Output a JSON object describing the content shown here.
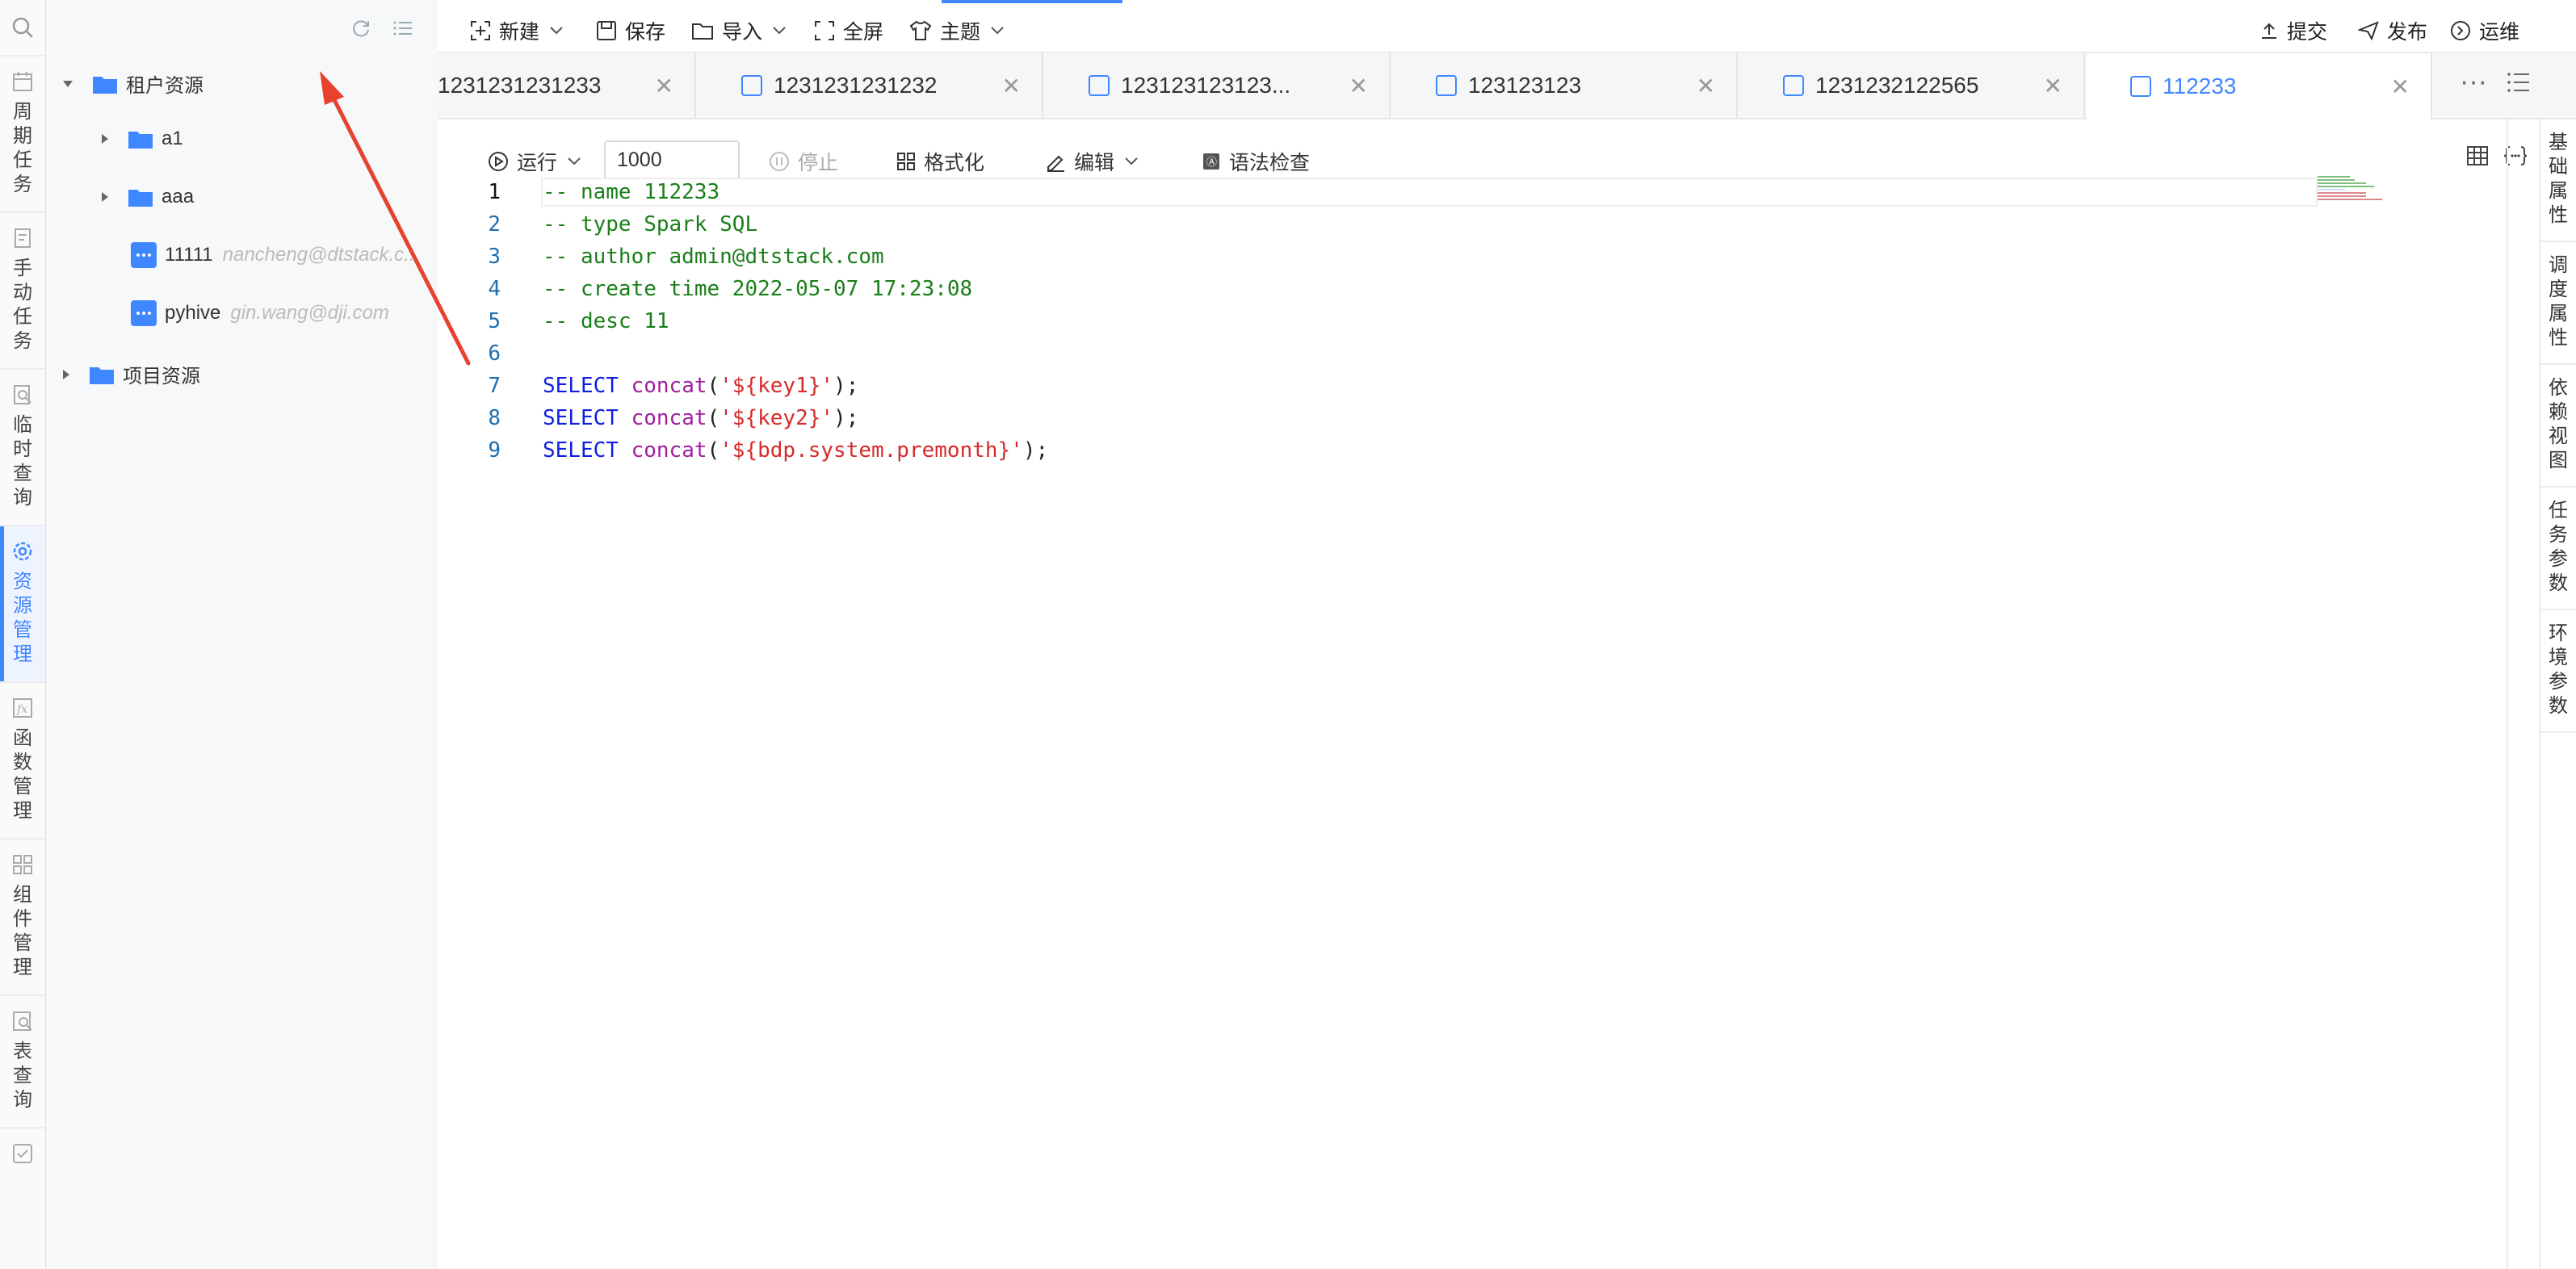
{
  "rail": {
    "items": [
      {
        "label": "周期任务",
        "icon": "calendar-icon",
        "active": false
      },
      {
        "label": "手动任务",
        "icon": "manual-task-icon",
        "active": false
      },
      {
        "label": "临时查询",
        "icon": "temp-query-icon",
        "active": false
      },
      {
        "label": "资源管理",
        "icon": "gear-icon",
        "active": true
      },
      {
        "label": "函数管理",
        "icon": "function-icon",
        "active": false
      },
      {
        "label": "组件管理",
        "icon": "component-icon",
        "active": false
      },
      {
        "label": "表查询",
        "icon": "table-query-icon",
        "active": false
      }
    ]
  },
  "tree": {
    "root1": "租户资源",
    "folders": [
      "a1",
      "aaa"
    ],
    "files": [
      {
        "name": "11111",
        "owner": "nancheng@dtstack.c..."
      },
      {
        "name": "pyhive",
        "owner": "gin.wang@dji.com"
      }
    ],
    "root2": "项目资源"
  },
  "toolbar": {
    "new": "新建",
    "save": "保存",
    "import": "导入",
    "fullscreen": "全屏",
    "theme": "主题",
    "submit": "提交",
    "publish": "发布",
    "ops": "运维"
  },
  "tabs": [
    {
      "name": "1231231231233",
      "active": false
    },
    {
      "name": "1231231231232",
      "active": false
    },
    {
      "name": "123123123123...",
      "active": false
    },
    {
      "name": "123123123",
      "active": false
    },
    {
      "name": "1231232122565",
      "active": false
    },
    {
      "name": "112233",
      "active": true
    }
  ],
  "editor_toolbar": {
    "run": "运行",
    "limit_value": "1000",
    "stop": "停止",
    "format": "格式化",
    "edit": "编辑",
    "syntax_check": "语法检查"
  },
  "code": {
    "comments": [
      "-- name 112233",
      "-- type Spark SQL",
      "-- author admin@dtstack.com",
      "-- create time 2022-05-07 17:23:08",
      "-- desc 11"
    ],
    "selects": [
      {
        "kw": "SELECT",
        "fn": "concat",
        "arg": "'${key1}'"
      },
      {
        "kw": "SELECT",
        "fn": "concat",
        "arg": "'${key2}'"
      },
      {
        "kw": "SELECT",
        "fn": "concat",
        "arg": "'${bdp.system.premonth}'"
      }
    ],
    "line_numbers": [
      "1",
      "2",
      "3",
      "4",
      "5",
      "6",
      "7",
      "8",
      "9"
    ],
    "colors": {
      "comment": "#1a7f1a",
      "keyword": "#1020e0",
      "function": "#a020a0",
      "string": "#d62b2b"
    }
  },
  "right_panel": [
    "基础属性",
    "调度属性",
    "依赖视图",
    "任务参数",
    "环境参数"
  ],
  "accent": "#3f87ff",
  "annotation_color": "#e8412e"
}
